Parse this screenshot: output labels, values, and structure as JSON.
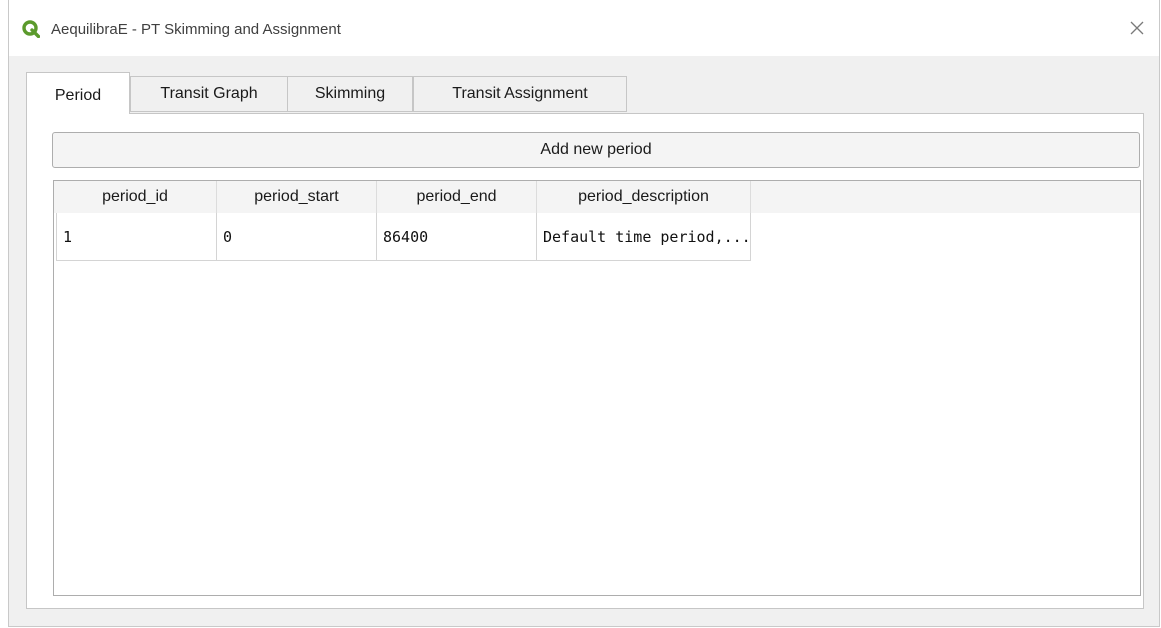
{
  "window": {
    "title": "AequilibraE - PT Skimming and Assignment",
    "icon": "qgis-logo-icon",
    "close_icon": "close-icon"
  },
  "tabs": [
    {
      "label": "Period",
      "active": true
    },
    {
      "label": "Transit Graph",
      "active": false
    },
    {
      "label": "Skimming",
      "active": false
    },
    {
      "label": "Transit Assignment",
      "active": false
    }
  ],
  "period_tab": {
    "add_button_label": "Add new period",
    "table": {
      "columns": [
        "period_id",
        "period_start",
        "period_end",
        "period_description"
      ],
      "rows": [
        [
          "1",
          "0",
          "86400",
          "Default time period,..."
        ]
      ]
    }
  },
  "colors": {
    "qgis_green": "#5b9a2c",
    "window_bg": "#f0f0f0",
    "panel_bg": "#ffffff"
  }
}
